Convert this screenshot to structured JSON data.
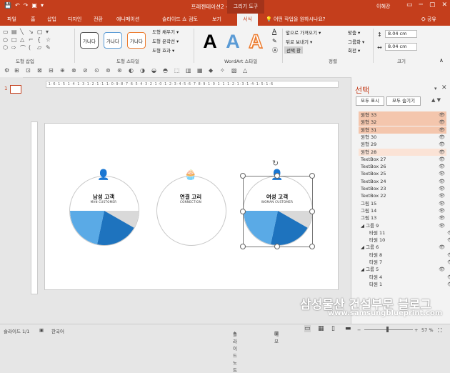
{
  "window": {
    "title": "프레젠테이션2 - PowerPoint",
    "context_tab": "그리기 도구",
    "user": "이혜강",
    "quick_access": [
      "💾",
      "↶",
      "↷",
      "▣",
      "▾"
    ],
    "win_buttons": [
      "▭",
      "─",
      "▢",
      "✕"
    ]
  },
  "tabs": [
    "파일",
    "홈",
    "삽입",
    "디자인",
    "전환",
    "애니메이션",
    "슬라이드 쇼",
    "검토",
    "보기",
    "서식"
  ],
  "active_tab": "서식",
  "tell_me": "어떤 작업을 원하시나요?",
  "share": "공유",
  "ribbon": {
    "groups": [
      "도형 삽입",
      "도형 스타일",
      "WordArt 스타일",
      "정렬",
      "크기"
    ],
    "style_boxes": [
      "가나다",
      "가나다",
      "가나다"
    ],
    "shape_menu": [
      "도형 채우기 ▾",
      "도형 윤곽선 ▾",
      "도형 효과 ▾"
    ],
    "wordart_letters": [
      "A",
      "A",
      "A"
    ],
    "arrange": [
      "앞으로 가져오기 ▾",
      "뒤로 보내기 ▾",
      "선택 창",
      "맞춤 ▾",
      "그룹화 ▾",
      "회전 ▾"
    ],
    "size": [
      "8.04 cm",
      "8.04 cm"
    ]
  },
  "slide_number": "1",
  "slide": {
    "circles": [
      {
        "title": "남성 고객",
        "subtitle": "MAN CUSTOMER",
        "icon": "man-icon",
        "icon_glyph": "👤",
        "icon_color": "#4aa3df"
      },
      {
        "title": "연결 고리",
        "subtitle": "CONNECTION",
        "icon": "cupcake-icon",
        "icon_glyph": "🧁",
        "icon_color": "#9b59b6"
      },
      {
        "title": "여성 고객",
        "subtitle": "WOMAN CUSTOMER",
        "icon": "woman-icon",
        "icon_glyph": "👤",
        "icon_color": "#e056b8"
      }
    ],
    "colors": {
      "dark_blue": "#1e73be",
      "light_blue": "#5aaae6",
      "gray": "#d9d9d9"
    }
  },
  "selection_pane": {
    "title": "선택",
    "show_all": "모두 표시",
    "hide_all": "모두 숨기기",
    "items": [
      {
        "label": "원형 33",
        "selected": true
      },
      {
        "label": "원형 32",
        "selected": true
      },
      {
        "label": "원형 31",
        "selected": true
      },
      {
        "label": "원형 30",
        "selected": false
      },
      {
        "label": "원형 29",
        "selected": false
      },
      {
        "label": "원형 28",
        "selected": "light"
      },
      {
        "label": "TextBox 27",
        "selected": false
      },
      {
        "label": "TextBox 26",
        "selected": false
      },
      {
        "label": "TextBox 25",
        "selected": false
      },
      {
        "label": "TextBox 24",
        "selected": false
      },
      {
        "label": "TextBox 23",
        "selected": false
      },
      {
        "label": "TextBox 22",
        "selected": false
      },
      {
        "label": "그림 15",
        "selected": false
      },
      {
        "label": "그림 14",
        "selected": false
      },
      {
        "label": "그림 13",
        "selected": false
      },
      {
        "label": "◢ 그룹 9",
        "selected": false
      },
      {
        "label": "타원 11",
        "selected": false
      },
      {
        "label": "타원 10",
        "selected": false
      },
      {
        "label": "◢ 그룹 6",
        "selected": false
      },
      {
        "label": "타원 8",
        "selected": false
      },
      {
        "label": "타원 7",
        "selected": false
      },
      {
        "label": "◢ 그룹 5",
        "selected": false
      },
      {
        "label": "타원 4",
        "selected": false
      },
      {
        "label": "타원 1",
        "selected": false
      }
    ]
  },
  "status": {
    "slide_info": "슬라이드 1/1",
    "language": "한국어",
    "notes": "슬라이드 노트",
    "comments": "메모",
    "zoom": "57 %"
  },
  "watermark": {
    "line1": "삼성물산 건설부문 블로그",
    "line2": "www.samsungblueprint.com"
  }
}
